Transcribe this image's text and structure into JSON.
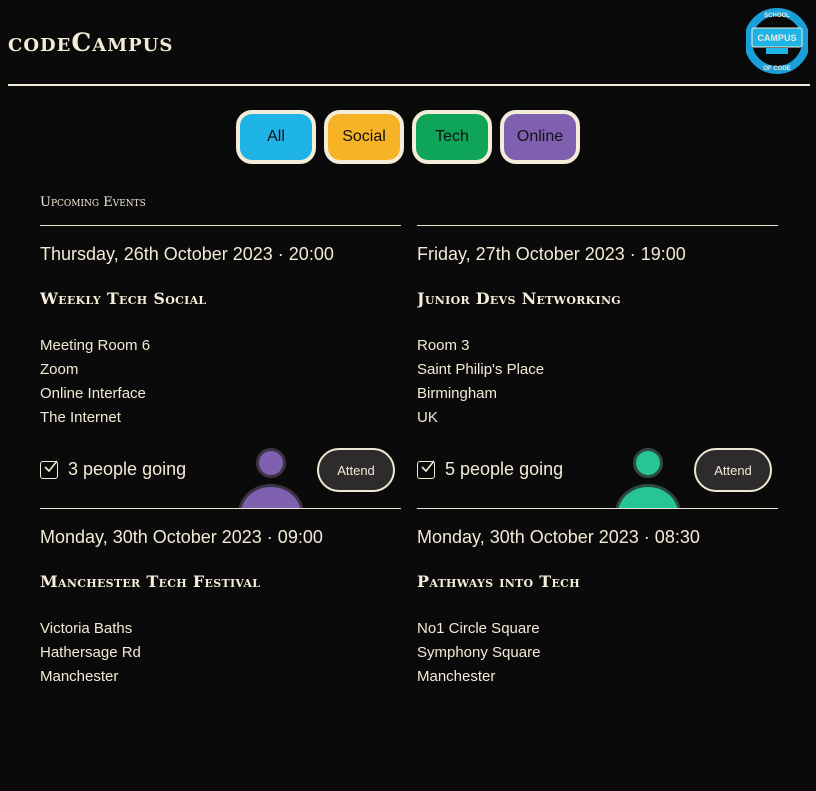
{
  "header": {
    "brand": "codeCampus",
    "logo_text": {
      "top": "SCHOOL",
      "middle": "CAMPUS",
      "bottom": "OF CODE"
    }
  },
  "filters": [
    {
      "label": "All",
      "color": "#1fb4e6"
    },
    {
      "label": "Social",
      "color": "#f7b326"
    },
    {
      "label": "Tech",
      "color": "#0fa559"
    },
    {
      "label": "Online",
      "color": "#7f5fb0"
    }
  ],
  "section_title": "Upcoming Events",
  "events": [
    {
      "date": "Thursday, 26th October 2023 · 20:00",
      "title": "Weekly Tech Social",
      "location": [
        "Meeting Room 6",
        "Zoom",
        "Online Interface",
        "The Internet"
      ],
      "going": "3 people going",
      "attend_label": "Attend",
      "avatar_color": "#7f5fb0"
    },
    {
      "date": "Friday, 27th October 2023 · 19:00",
      "title": "Junior Devs Networking",
      "location": [
        "Room 3",
        "Saint Philip's Place",
        "Birmingham",
        "UK"
      ],
      "going": "5 people going",
      "attend_label": "Attend",
      "avatar_color": "#27c596"
    },
    {
      "date": "Monday, 30th October 2023 · 09:00",
      "title": "Manchester Tech Festival",
      "location": [
        "Victoria Baths",
        "Hathersage Rd",
        "Manchester"
      ]
    },
    {
      "date": "Monday, 30th October 2023 · 08:30",
      "title": "Pathways into Tech",
      "location": [
        "No1 Circle Square",
        "Symphony Square",
        "Manchester"
      ]
    }
  ]
}
